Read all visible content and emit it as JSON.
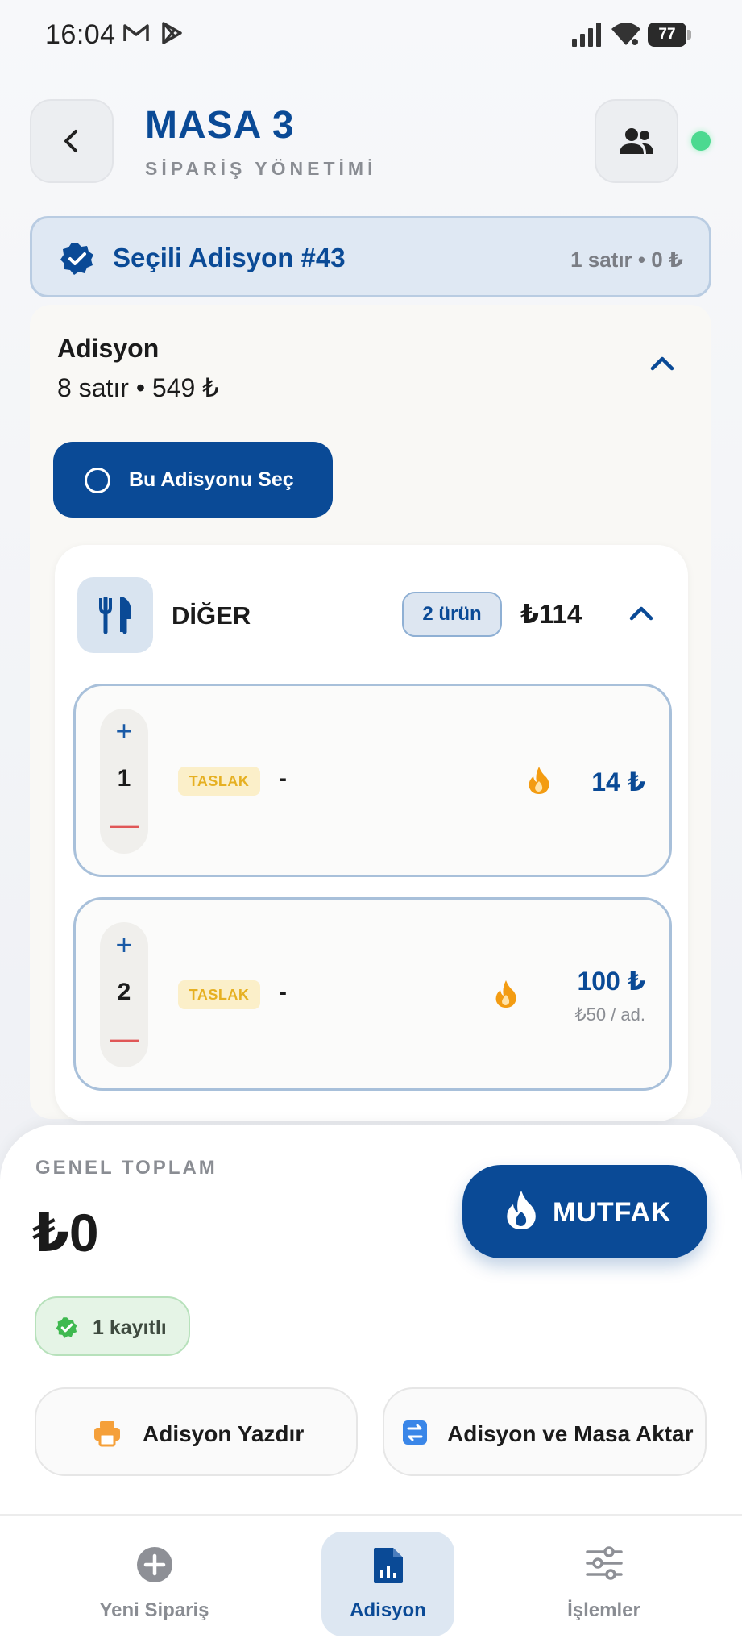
{
  "status_bar": {
    "time": "16:04",
    "battery": "77",
    "icons": [
      "gmail-icon",
      "play-store-icon",
      "signal-icon",
      "wifi-icon",
      "battery-icon"
    ]
  },
  "header": {
    "title": "MASA 3",
    "subtitle": "SİPARİŞ YÖNETİMİ",
    "back_icon": "chevron-left-icon",
    "people_icon": "people-icon",
    "online": true
  },
  "selected": {
    "title": "Seçili Adisyon #43",
    "meta": "1 satır • 0 ₺"
  },
  "adisyon": {
    "title": "Adisyon",
    "meta": "8 satır • 549 ₺",
    "select_button": "Bu Adisyonu Seç",
    "category": {
      "name": "DİĞER",
      "badge": "2 ürün",
      "total": "₺114",
      "icon": "utensils-icon"
    },
    "items": [
      {
        "qty": "1",
        "badge": "TASLAK",
        "name": "-",
        "price": "14 ₺",
        "unit": ""
      },
      {
        "qty": "2",
        "badge": "TASLAK",
        "name": "-",
        "price": "100 ₺",
        "unit": "₺50 / ad."
      }
    ]
  },
  "summary": {
    "label": "GENEL TOPLAM",
    "total": "₺0",
    "saved": "1 kayıtlı",
    "kitchen_button": "MUTFAK",
    "print_button": "Adisyon Yazdır",
    "transfer_button": "Adisyon ve Masa Aktar"
  },
  "nav": {
    "items": [
      {
        "label": "Yeni Sipariş",
        "icon": "plus-circle-icon",
        "active": false
      },
      {
        "label": "Adisyon",
        "icon": "receipt-icon",
        "active": true
      },
      {
        "label": "İşlemler",
        "icon": "sliders-icon",
        "active": false
      }
    ]
  },
  "colors": {
    "brand": "#0a4a96",
    "success": "#3fb950",
    "warning": "#f39c12",
    "danger": "#e05757"
  }
}
